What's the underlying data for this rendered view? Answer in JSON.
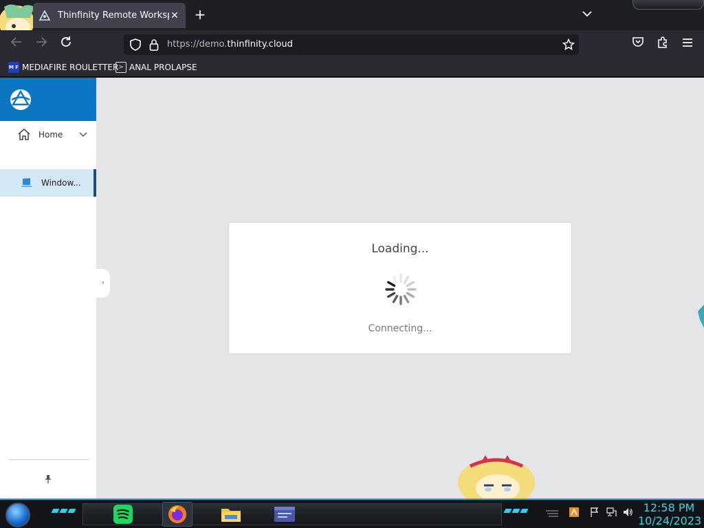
{
  "browser": {
    "tab": {
      "title": "Thinfinity Remote Workspace",
      "favicon": "thinfinity-icon"
    },
    "url": {
      "prefix": "https://demo.",
      "host": "thinfinity.cloud",
      "suffix": ""
    },
    "bookmarks": [
      {
        "label": "MEDIAFIRE ROULETTER",
        "icon": "mediafire-icon"
      },
      {
        "label": "ANAL PROLAPSE",
        "icon": "terminal-icon"
      }
    ]
  },
  "app": {
    "sidebar": {
      "home_label": "Home",
      "selected_item_label": "Window..."
    },
    "loading": {
      "title": "Loading...",
      "status": "Connecting..."
    }
  },
  "taskbar": {
    "apps": [
      {
        "name": "spotify",
        "icon": "spotify-icon"
      },
      {
        "name": "firefox",
        "icon": "firefox-icon",
        "active": true
      },
      {
        "name": "file-explorer",
        "icon": "folder-icon"
      },
      {
        "name": "remote-desktop",
        "icon": "window-icon"
      }
    ],
    "clock": {
      "time": "12:58 PM",
      "date": "10/24/2023"
    }
  },
  "colors": {
    "brand_blue": "#0b76c4",
    "selected_item_bg": "#d4e7f5",
    "selected_item_border": "#1c4e78",
    "clock_cyan": "#36d5e6",
    "content_bg": "#e4e5e7"
  }
}
